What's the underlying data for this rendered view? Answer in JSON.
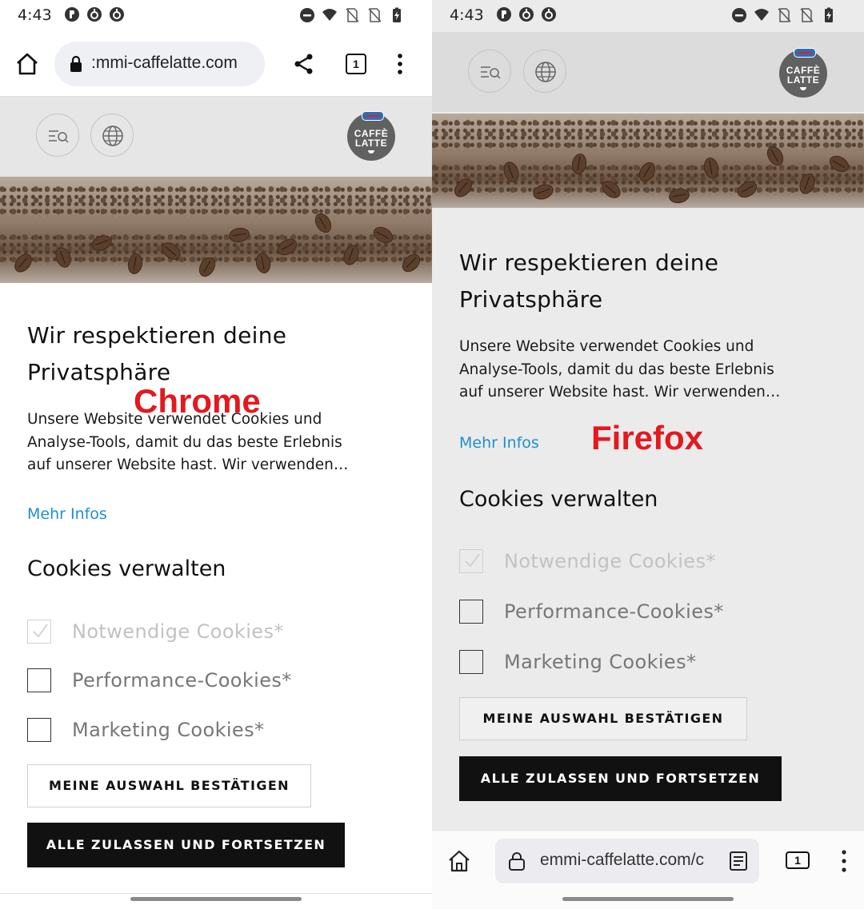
{
  "status": {
    "time": "4:43"
  },
  "chrome": {
    "url": ":mmi-caffelatte.com",
    "tab_count": "1",
    "label": "Chrome"
  },
  "firefox": {
    "url": "emmi-caffelatte.com/c",
    "tab_count": "1",
    "label": "Firefox"
  },
  "logo": {
    "line1": "CAFFÈ",
    "line2": "LATTE"
  },
  "consent": {
    "title_line1": "Wir respektieren deine",
    "title_line2": "Privatsphäre",
    "intro_line1": "Unsere Website verwendet Cookies und",
    "intro_line2": "Analyse-Tools, damit du das beste Erlebnis",
    "intro_line3": "auf unserer Website hast. Wir verwenden…",
    "more_info": "Mehr Infos",
    "manage_title": "Cookies verwalten",
    "options": [
      {
        "label": "Notwendige Cookies*",
        "checked": true,
        "disabled": true
      },
      {
        "label": "Performance-Cookies*",
        "checked": false,
        "disabled": false
      },
      {
        "label": "Marketing Cookies*",
        "checked": false,
        "disabled": false
      }
    ],
    "confirm_button": "MEINE AUSWAHL BESTÄTIGEN",
    "accept_all_button": "ALLE ZULASSEN UND FORTSETZEN"
  }
}
